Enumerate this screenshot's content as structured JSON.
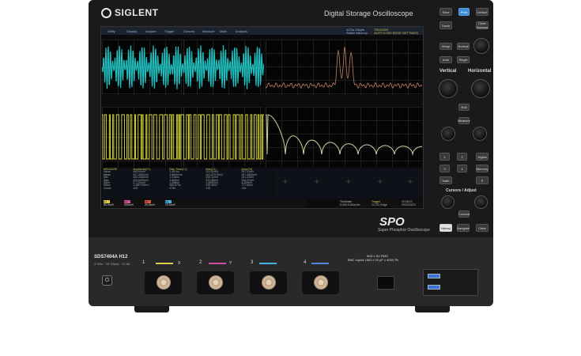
{
  "brand": "SIGLENT",
  "model_title": "Digital Storage Oscilloscope",
  "menu": [
    "Utility",
    "Display",
    "Acquire",
    "Trigger",
    "Cursors",
    "Measure",
    "Math",
    "Analysis"
  ],
  "status": {
    "acq_line1": "4GSa 20kpts",
    "acq_line2": "Stable Memory",
    "trig_line1": "TRIGGER",
    "trig_line2": "AUTO 0.00V EDGE SETTINGS"
  },
  "measure_table": {
    "headers": [
      "MEASURE",
      "Amplitude(C1)",
      "Rise Time(C1)",
      "Max(C1)",
      "Amp(C3)"
    ],
    "rows": [
      {
        "label": "Value",
        "v": [
          "406.84mV",
          "3.457ns",
          "202.62mV",
          "397.41mV"
        ]
      },
      {
        "label": "Mean",
        "v": [
          "407.0952mV",
          "2.86991ns",
          "201.67075mV",
          "197.3565mV"
        ]
      },
      {
        "label": "Min",
        "v": [
          "400.2400mV",
          "1.418ns",
          "200.12mV",
          "191.20mV"
        ]
      },
      {
        "label": "Max",
        "v": [
          "409.6000mV",
          "2.653ns",
          "202.58mV",
          "206.32mV"
        ]
      },
      {
        "label": "Sdev",
        "v": [
          "0.7720mV",
          "1.498ns",
          "1.0802mV",
          "4.209mV"
        ]
      },
      {
        "label": "Stdev",
        "v": [
          "1.38E+00mV",
          "380.87ns",
          "415.46uV",
          "777.60uV"
        ]
      },
      {
        "label": "Count",
        "v": [
          "125",
          "4796",
          "125",
          "135"
        ]
      }
    ]
  },
  "channel_bar": [
    {
      "label": "C1",
      "value": "50.0mV/",
      "color": "#d8d040"
    },
    {
      "label": "C2",
      "value": "200mV/",
      "color": "#d050a0"
    },
    {
      "label": "C3",
      "value": "20.0mV/",
      "color": "#e05040"
    },
    {
      "label": "C4",
      "value": "10.0mV/",
      "color": "#40b0e0"
    }
  ],
  "timebase": {
    "label": "Timebase",
    "value": "0.00s 5.00us/div",
    "trigger_label": "Trigger",
    "trigger_value": "C1 DC Edge",
    "time": "10:08:12",
    "date": "2022/04/23"
  },
  "spo_logo": "SPO",
  "spo_sub": "Super Phosphor Oscilloscope",
  "panel": {
    "vertical_label": "Vertical",
    "horizontal_label": "Horizontal",
    "cursors_label": "Cursors / Adjust",
    "buttons": {
      "save": "Save",
      "print": "Print",
      "default": "Default",
      "touch": "Touch",
      "clear_sweeps": "Clear Sweeps",
      "setup": "Setup",
      "normal": "Normal",
      "auto": "Auto",
      "single": "Single",
      "roll": "Roll",
      "measure": "Measure",
      "math": "Math",
      "search": "Search",
      "digital": "Digital",
      "memory": "Memory",
      "ref": "Ref",
      "cursors": "Cursors",
      "history": "History",
      "navigate": "Navigate",
      "clear": "Clear",
      "ch1": "1",
      "ch2": "2",
      "ch3": "3",
      "ch4": "4"
    }
  },
  "front": {
    "model": "SDS7404A H12",
    "model_sub": "4 GHz · 20 GSa/s · 12-bit",
    "channels": [
      {
        "num": "1",
        "letter": "X",
        "color": "#d8d040"
      },
      {
        "num": "2",
        "letter": "Y",
        "color": "#d050a0"
      },
      {
        "num": "3",
        "letter": "",
        "color": "#40b0e0"
      },
      {
        "num": "4",
        "letter": "",
        "color": "#5088e0"
      }
    ],
    "warn_line1": "50Ω ≤ 5V RMS",
    "warn_line2": "BNC Inputs 1MΩ // 20 pF ≤ 400V Pk"
  },
  "colors": {
    "ch1": "#e0e040",
    "ch2": "#20c0c0",
    "fft": "#c08060",
    "accent": "#3f8bd6"
  }
}
